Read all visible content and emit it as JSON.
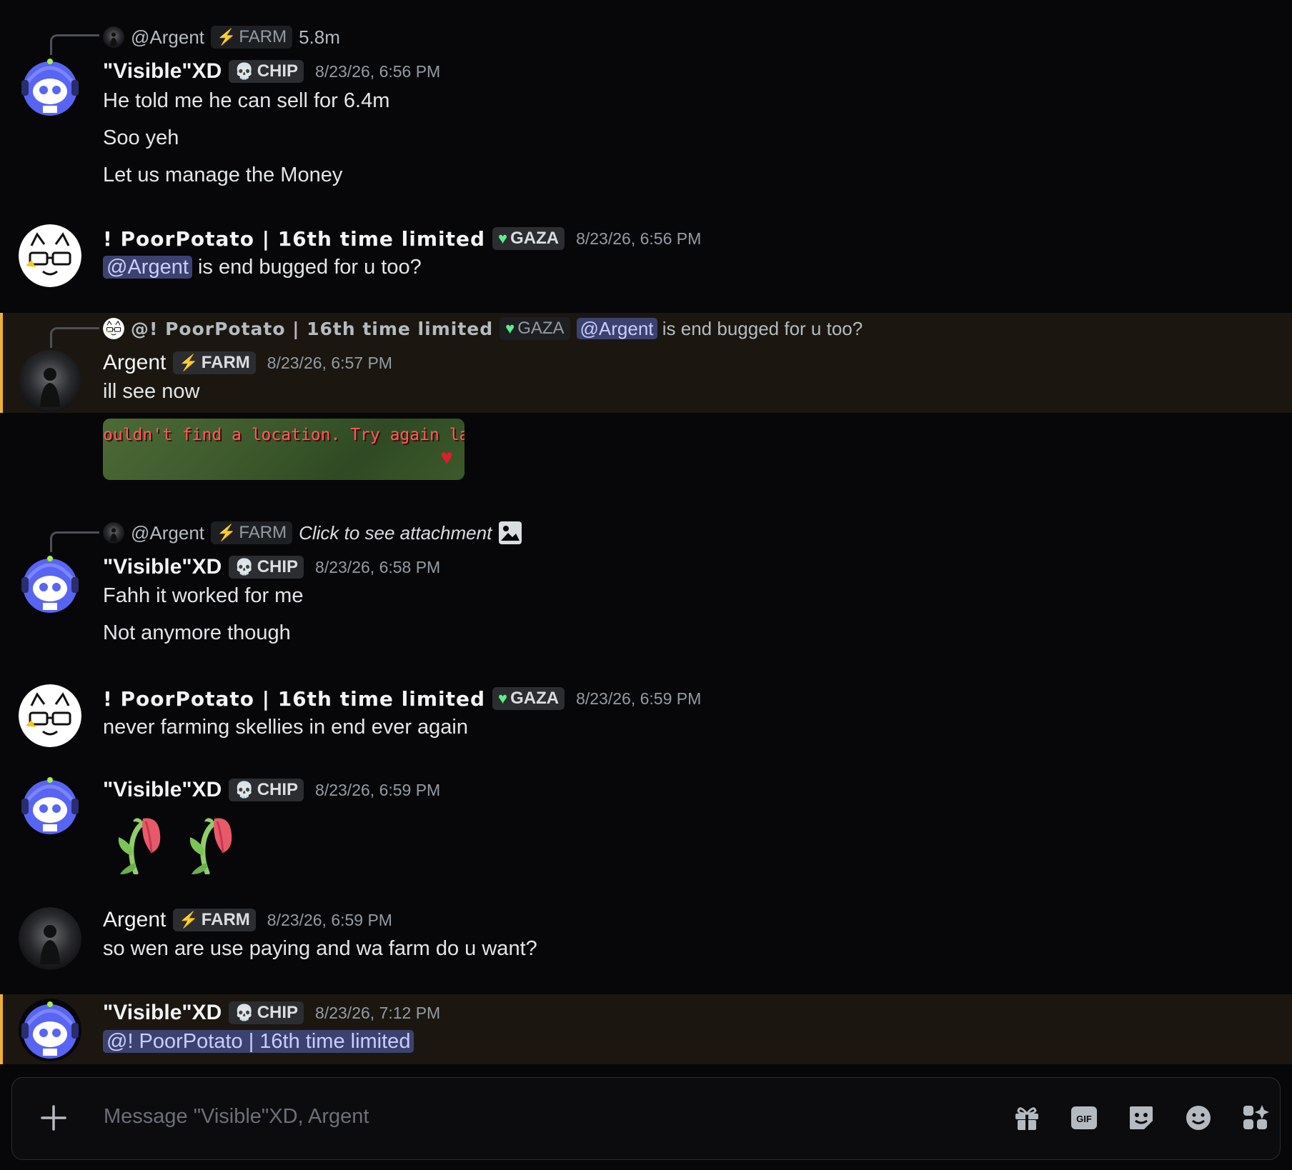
{
  "messages": {
    "m1": {
      "reply_author": "@Argent",
      "reply_tag": "FARM",
      "reply_text": "5.8m",
      "author": "\"Visible\"XD",
      "tag": "CHIP",
      "time": "8/23/26, 6:56 PM",
      "lines": [
        "He told me he can sell for 6.4m",
        "Soo yeh",
        "Let us manage the Money"
      ]
    },
    "m2": {
      "author": "! PoorPotato | 16th time limited",
      "tag": "GAZA",
      "time": "8/23/26, 6:56 PM",
      "mention": "@Argent",
      "text": " is end bugged for u too?"
    },
    "m3": {
      "reply_author": "@! PoorPotato | 16th time limited",
      "reply_tag": "GAZA",
      "reply_mention": "@Argent",
      "reply_text": " is end bugged for u too?",
      "author": "Argent",
      "tag": "FARM",
      "time": "8/23/26, 6:57 PM",
      "text": "ill see now",
      "attachment_caption": "ouldn't find a location. Try again later"
    },
    "m4": {
      "reply_author": "@Argent",
      "reply_tag": "FARM",
      "reply_text": "Click to see attachment",
      "author": "\"Visible\"XD",
      "tag": "CHIP",
      "time": "8/23/26, 6:58 PM",
      "lines": [
        "Fahh it worked for me",
        "Not anymore though"
      ]
    },
    "m5": {
      "author": "! PoorPotato | 16th time limited",
      "tag": "GAZA",
      "time": "8/23/26, 6:59 PM",
      "text": "never farming skellies in end ever again"
    },
    "m6": {
      "author": "\"Visible\"XD",
      "tag": "CHIP",
      "time": "8/23/26, 6:59 PM",
      "emoji": [
        "wilted-flower",
        "wilted-flower"
      ]
    },
    "m7": {
      "author": "Argent",
      "tag": "FARM",
      "time": "8/23/26, 6:59 PM",
      "text": "so wen are use paying and wa farm do u want?"
    },
    "m8": {
      "author": "\"Visible\"XD",
      "tag": "CHIP",
      "time": "8/23/26, 7:12 PM",
      "mention": "@! PoorPotato | 16th time limited"
    }
  },
  "composer": {
    "placeholder": "Message \"Visible\"XD, Argent",
    "gif_label": "GIF",
    "icons": [
      "plus-icon",
      "gift-icon",
      "gif-icon",
      "sticker-icon",
      "emoji-icon",
      "apps-icon"
    ]
  },
  "colors": {
    "highlight_bar": "#f0b132",
    "highlight_bg": "#1b1710",
    "mention_bg": "#3c4270",
    "mention_text": "#c9cdfb",
    "farm_icon": "#5865f2",
    "gaza_icon": "#57f287",
    "chip_icon": "#3ba55c"
  }
}
